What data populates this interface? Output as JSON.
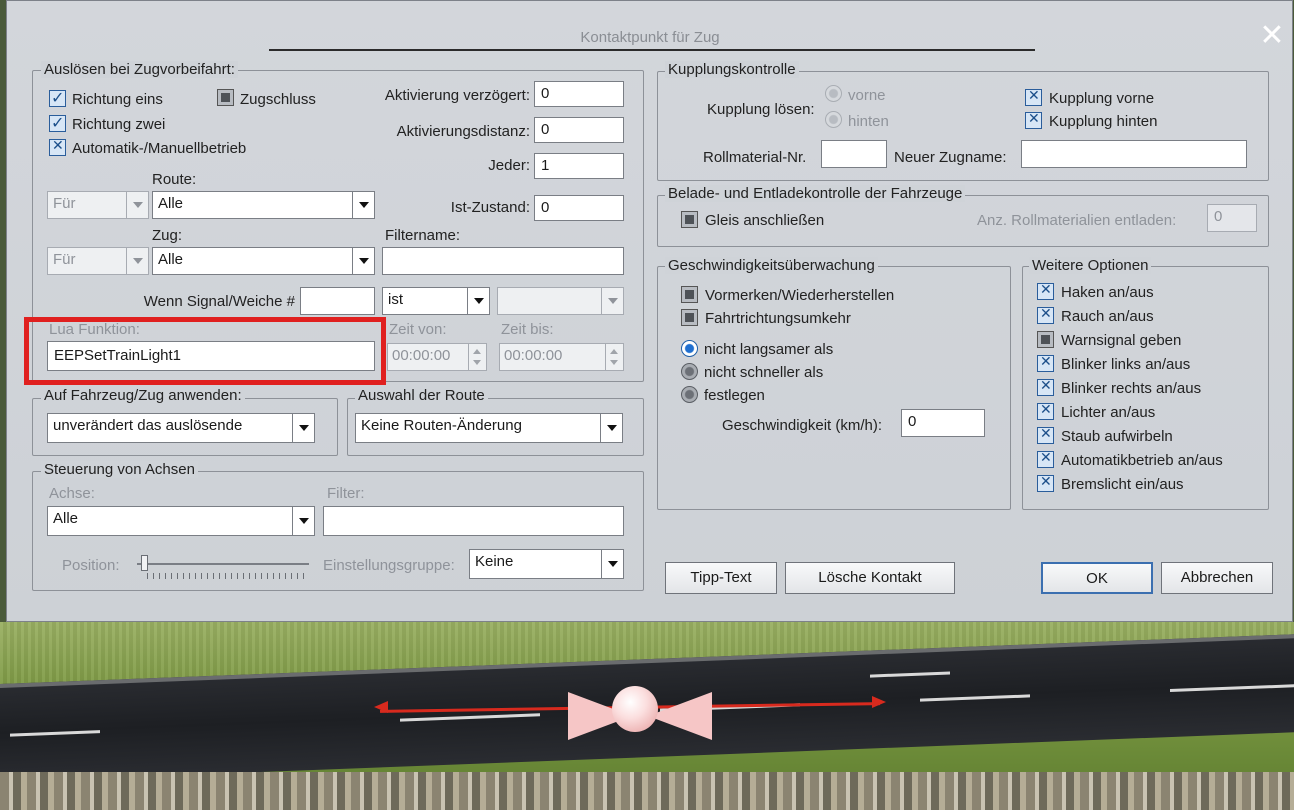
{
  "dialog": {
    "title": "Kontaktpunkt für Zug",
    "close_symbol": "✕"
  },
  "trigger": {
    "legend": "Auslösen bei Zugvorbeifahrt:",
    "richtung_eins": "Richtung eins",
    "richtung_zwei": "Richtung zwei",
    "zugschluss": "Zugschluss",
    "automatik": "Automatik-/Manuellbetrieb",
    "aktivierung_label": "Aktivierung verzögert:",
    "aktivierung_value": "0",
    "distanz_label": "Aktivierungsdistanz:",
    "distanz_value": "0",
    "jeder_label": "Jeder:",
    "jeder_value": "1",
    "route_label": "Route:",
    "route_qual": "Für",
    "route_value": "Alle",
    "ist_zustand_label": "Ist-Zustand:",
    "ist_zustand_value": "0",
    "zug_label": "Zug:",
    "zug_qual": "Für",
    "zug_value": "Alle",
    "filtername_label": "Filtername:",
    "filtername_value": "",
    "signal_label": "Wenn Signal/Weiche #",
    "signal_value": "",
    "ist_value": "ist",
    "state_value": "",
    "lua_label": "Lua Funktion:",
    "lua_value": "EEPSetTrainLight1",
    "zeit_von_label": "Zeit von:",
    "zeit_von_value": "00:00:00",
    "zeit_bis_label": "Zeit bis:",
    "zeit_bis_value": "00:00:00"
  },
  "apply": {
    "legend": "Auf Fahrzeug/Zug anwenden:",
    "value": "unverändert das auslösende"
  },
  "route_select": {
    "legend": "Auswahl der Route",
    "value": "Keine Routen-Änderung"
  },
  "axes": {
    "legend": "Steuerung von Achsen",
    "achse_label": "Achse:",
    "achse_value": "Alle",
    "filter_label": "Filter:",
    "filter_value": "",
    "position_label": "Position:",
    "gruppe_label": "Einstellungsgruppe:",
    "gruppe_value": "Keine"
  },
  "coupling": {
    "legend": "Kupplungskontrolle",
    "loesen_label": "Kupplung lösen:",
    "vorne": "vorne",
    "hinten": "hinten",
    "kupplung_vorne": "Kupplung vorne",
    "kupplung_hinten": "Kupplung hinten",
    "rollmaterial_label": "Rollmaterial-Nr.",
    "rollmaterial_value": "",
    "zugname_label": "Neuer Zugname:",
    "zugname_value": ""
  },
  "loading": {
    "legend": "Belade- und Entladekontrolle der Fahrzeuge",
    "gleis": "Gleis anschließen",
    "anz_label": "Anz. Rollmaterialien entladen:",
    "anz_value": "0"
  },
  "speed": {
    "legend": "Geschwindigkeitsüberwachung",
    "vormerken": "Vormerken/Wiederherstellen",
    "fahrtrichtung": "Fahrtrichtungsumkehr",
    "nicht_langsamer": "nicht langsamer als",
    "nicht_schneller": "nicht schneller als",
    "festlegen": "festlegen",
    "geschw_label": "Geschwindigkeit (km/h):",
    "geschw_value": "0"
  },
  "options": {
    "legend": "Weitere Optionen",
    "items": [
      {
        "label": "Haken an/aus",
        "state": "x"
      },
      {
        "label": "Rauch an/aus",
        "state": "x"
      },
      {
        "label": "Warnsignal geben",
        "state": "ind"
      },
      {
        "label": "Blinker links an/aus",
        "state": "x"
      },
      {
        "label": "Blinker rechts an/aus",
        "state": "x"
      },
      {
        "label": "Lichter an/aus",
        "state": "x"
      },
      {
        "label": "Staub aufwirbeln",
        "state": "x"
      },
      {
        "label": "Automatikbetrieb an/aus",
        "state": "x"
      },
      {
        "label": "Bremslicht ein/aus",
        "state": "x"
      }
    ]
  },
  "buttons": {
    "tipp": "Tipp-Text",
    "loesche": "Lösche Kontakt",
    "ok": "OK",
    "abbrechen": "Abbrechen"
  },
  "colors": {
    "highlight": "#e0201f",
    "checkbox_accent": "#1c4f8a",
    "contact_line": "#d82a1e"
  }
}
